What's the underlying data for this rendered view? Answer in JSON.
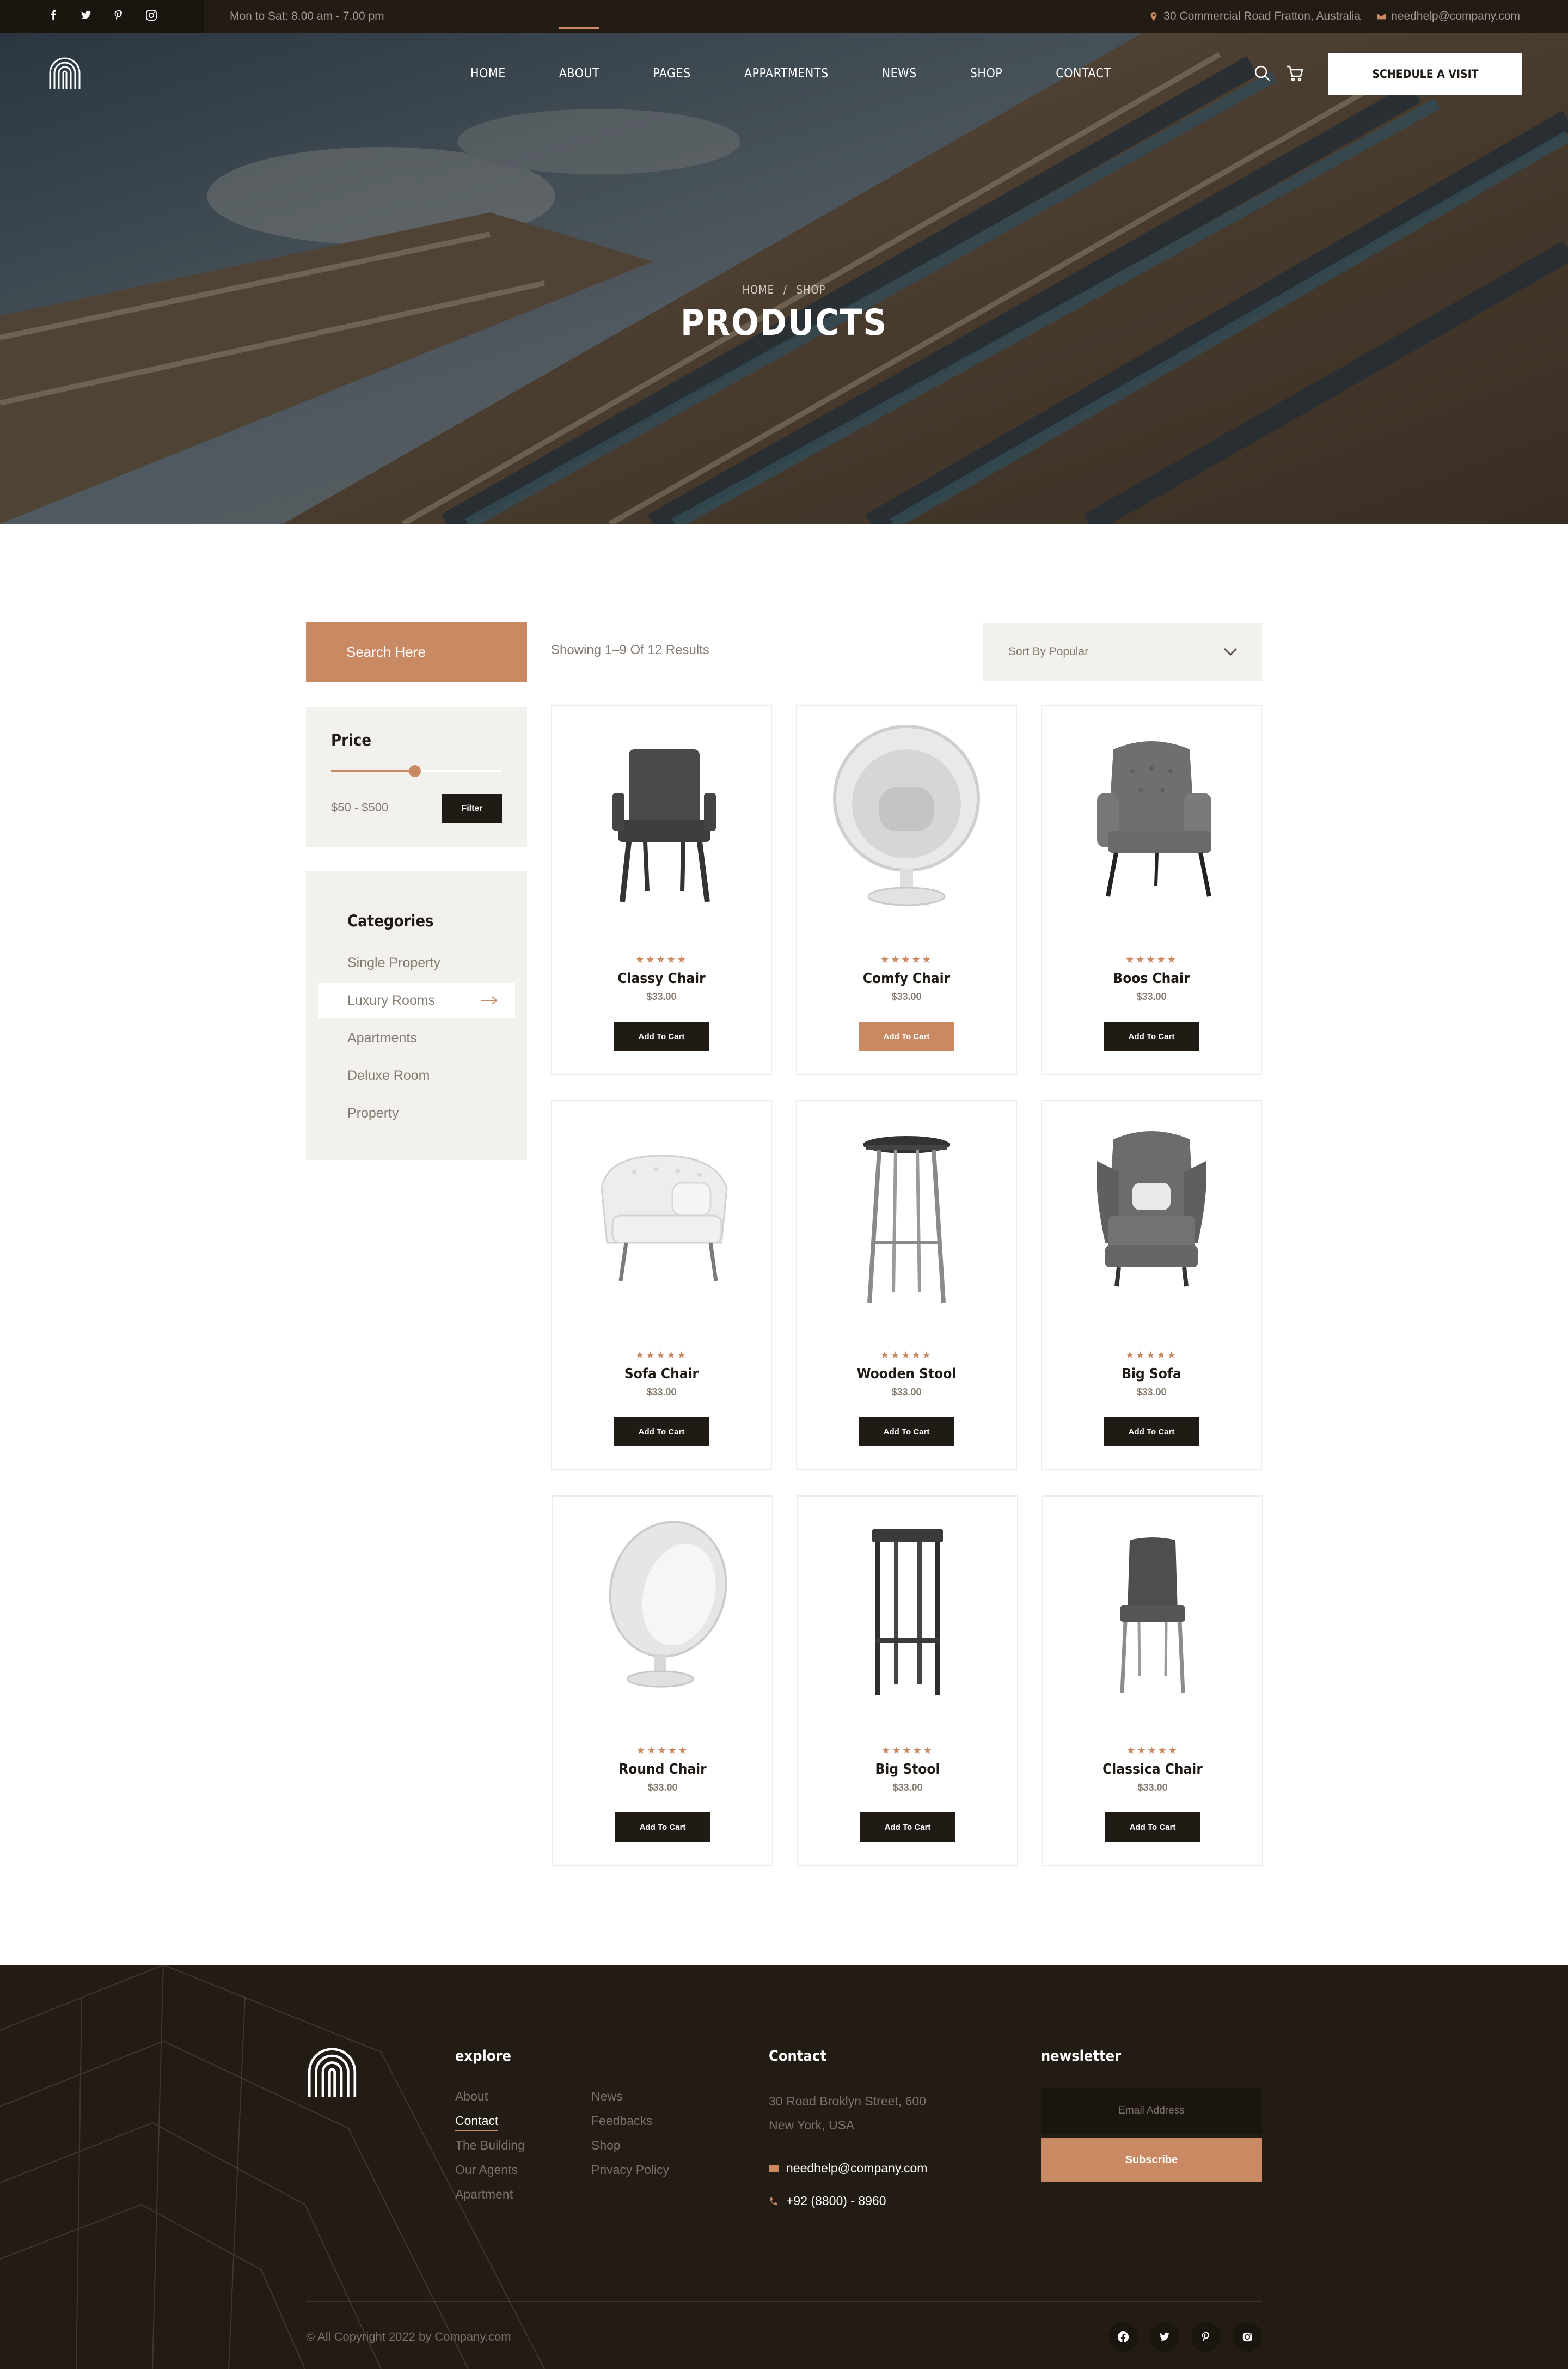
{
  "topbar": {
    "hours": "Mon to Sat: 8.00 am - 7.00 pm",
    "address": "30 Commercial Road Fratton, Australia",
    "email": "needhelp@company.com",
    "social": [
      "facebook-icon",
      "twitter-icon",
      "pinterest-icon",
      "instagram-icon"
    ]
  },
  "header": {
    "nav": [
      "Home",
      "About",
      "Pages",
      "Appartments",
      "News",
      "Shop",
      "Contact"
    ],
    "active_nav": "About",
    "cta": "Schedule a Visit"
  },
  "hero": {
    "breadcrumb_home": "Home",
    "breadcrumb_sep": "/",
    "breadcrumb_current": "Shop",
    "title": "Products"
  },
  "sidebar": {
    "search_placeholder": "Search Here",
    "price_title": "Price",
    "price_range": "$50 - $500",
    "price_slider_level": 0.49,
    "filter_label": "Filter",
    "categories_title": "Categories",
    "categories": [
      "Single Property",
      "Luxury Rooms",
      "Apartments",
      "Deluxe Room",
      "Property"
    ],
    "active_category": "Luxury Rooms"
  },
  "results": {
    "summary": "Showing 1–9 Of 12 Results",
    "sort_label": "Sort By Popular"
  },
  "products": [
    {
      "name": "Classy Chair",
      "price": "$33.00",
      "rating": 5,
      "button": "Add To Cart",
      "icon": "armchair-dark-icon"
    },
    {
      "name": "Comfy Chair",
      "price": "$33.00",
      "rating": 5,
      "button": "Add To Cart",
      "icon": "ball-chair-icon"
    },
    {
      "name": "Boos Chair",
      "price": "$33.00",
      "rating": 5,
      "button": "Add To Cart",
      "icon": "wingback-chair-icon"
    },
    {
      "name": "Sofa Chair",
      "price": "$33.00",
      "rating": 5,
      "button": "Add To Cart",
      "icon": "white-sofa-chair-icon"
    },
    {
      "name": "Wooden Stool",
      "price": "$33.00",
      "rating": 5,
      "button": "Add To Cart",
      "icon": "bar-stool-icon"
    },
    {
      "name": "Big Sofa",
      "price": "$33.00",
      "rating": 5,
      "button": "Add To Cart",
      "icon": "grey-wingback-icon"
    },
    {
      "name": "Round Chair",
      "price": "$33.00",
      "rating": 5,
      "button": "Add To Cart",
      "icon": "egg-chair-icon"
    },
    {
      "name": "Big Stool",
      "price": "$33.00",
      "rating": 5,
      "button": "Add To Cart",
      "icon": "square-stool-icon"
    },
    {
      "name": "Classica Chair",
      "price": "$33.00",
      "rating": 5,
      "button": "Add To Cart",
      "icon": "dining-chair-icon"
    }
  ],
  "footer": {
    "explore_title": "explore",
    "explore_col1": [
      "About",
      "Contact",
      "The Building",
      "Our Agents",
      "Apartment"
    ],
    "explore_col2": [
      "News",
      "Feedbacks",
      "Shop",
      "Privacy Policy"
    ],
    "active_link": "Contact",
    "contact_title": "Contact",
    "address_line1": "30 Road Broklyn Street, 600",
    "address_line2": "New York, USA",
    "email": "needhelp@company.com",
    "phone": "+92 (8800) - 8960",
    "newsletter_title": "newsletter",
    "email_placeholder": "Email Address",
    "subscribe_label": "Subscribe",
    "copyright": "© All Copyright 2022 by Company.com"
  },
  "colors": {
    "accent": "#c98a63",
    "dark": "#231c14",
    "panel": "#f3f1ed"
  }
}
